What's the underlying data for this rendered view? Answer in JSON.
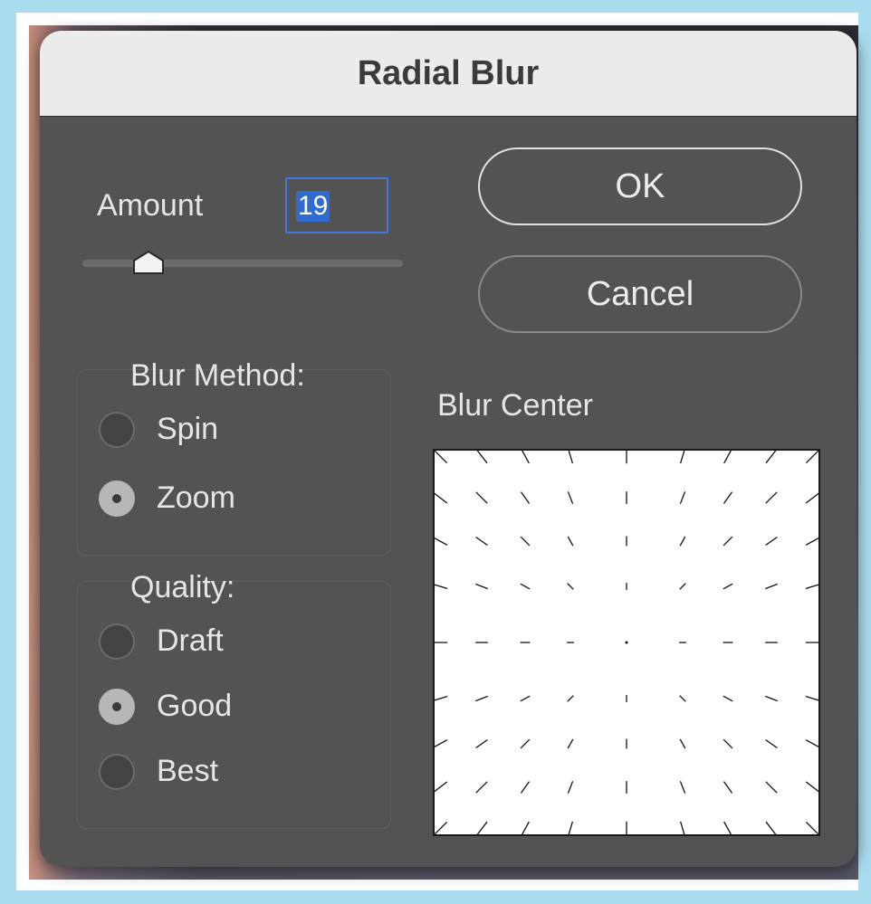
{
  "dialog": {
    "title": "Radial Blur"
  },
  "amount": {
    "label": "Amount",
    "value": "19",
    "slider_level_percent": 19
  },
  "buttons": {
    "ok": "OK",
    "cancel": "Cancel"
  },
  "blur_method": {
    "label": "Blur Method:",
    "options": [
      {
        "label": "Spin",
        "selected": false
      },
      {
        "label": "Zoom",
        "selected": true
      }
    ]
  },
  "quality": {
    "label": "Quality:",
    "options": [
      {
        "label": "Draft",
        "selected": false
      },
      {
        "label": "Good",
        "selected": true
      },
      {
        "label": "Best",
        "selected": false
      }
    ]
  },
  "blur_center": {
    "label": "Blur Center"
  },
  "colors": {
    "dialog_bg": "#535353",
    "titlebar_bg": "#ececec",
    "focus_ring": "#3f78e0",
    "selection": "#2f6bd0"
  }
}
